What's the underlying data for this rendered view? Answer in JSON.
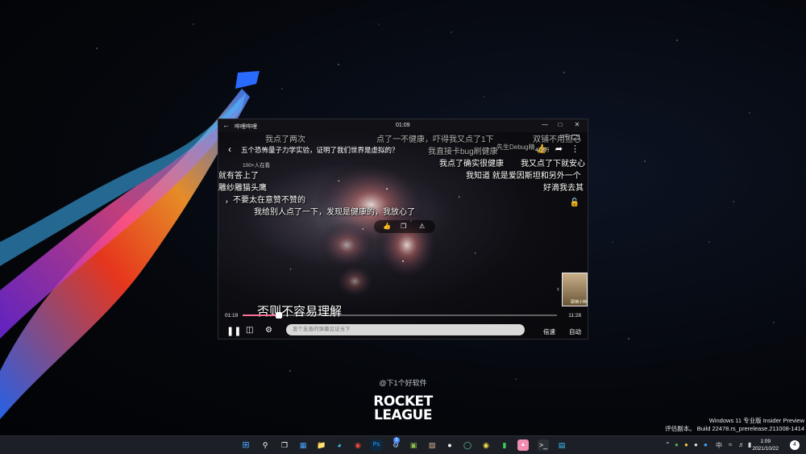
{
  "player": {
    "app_name": "哔哩哔哩",
    "clock": "01:09",
    "video_title": "五个恐怖量子力学实验，证明了我们世界是虚拟的？",
    "viewers": "100+人在看",
    "network": "WiFi",
    "likes": "47.8万",
    "subtitle": "否则不容易理解",
    "time_current": "01:19",
    "time_total": "11:28",
    "progress_fraction": 0.115,
    "danmaku_placeholder": "发个友善的弹幕见证当下",
    "speed_label": "倍速",
    "auto_label": "自动",
    "danmaku": [
      "我点了两次",
      "点了一不健康，吓得我又点了1下",
      "双铺不用担心",
      "我直接卡bug刷健康",
      "先生Debug精",
      "我点了确实很健康",
      "我又点了下就安心",
      "就有答上了",
      "我知道  就是爱因斯坦和另外一个",
      "雕纱雕猫头鹰",
      "好滴我去其",
      "，不要太在意赞不赞的",
      "我给别人点了一下，发现是健康的，我放心了"
    ],
    "thumb_label": "耶梯小种"
  },
  "desktop": {
    "watermark": "@下1个好软件",
    "game_logo_line1": "ROCKET",
    "game_logo_line2": "LEAGUE",
    "build_line1": "Windows 11 专业版 Insider Preview",
    "build_line2": "评估副本。 Build 22478.rs_prerelease.211008-1414"
  },
  "taskbar": {
    "ime": "中",
    "time": "1:09",
    "date": "2021/10/22",
    "notification_count": "4",
    "badge_count": "5"
  },
  "colors": {
    "accent": "#fb7299",
    "taskbar": "#1c2026"
  }
}
